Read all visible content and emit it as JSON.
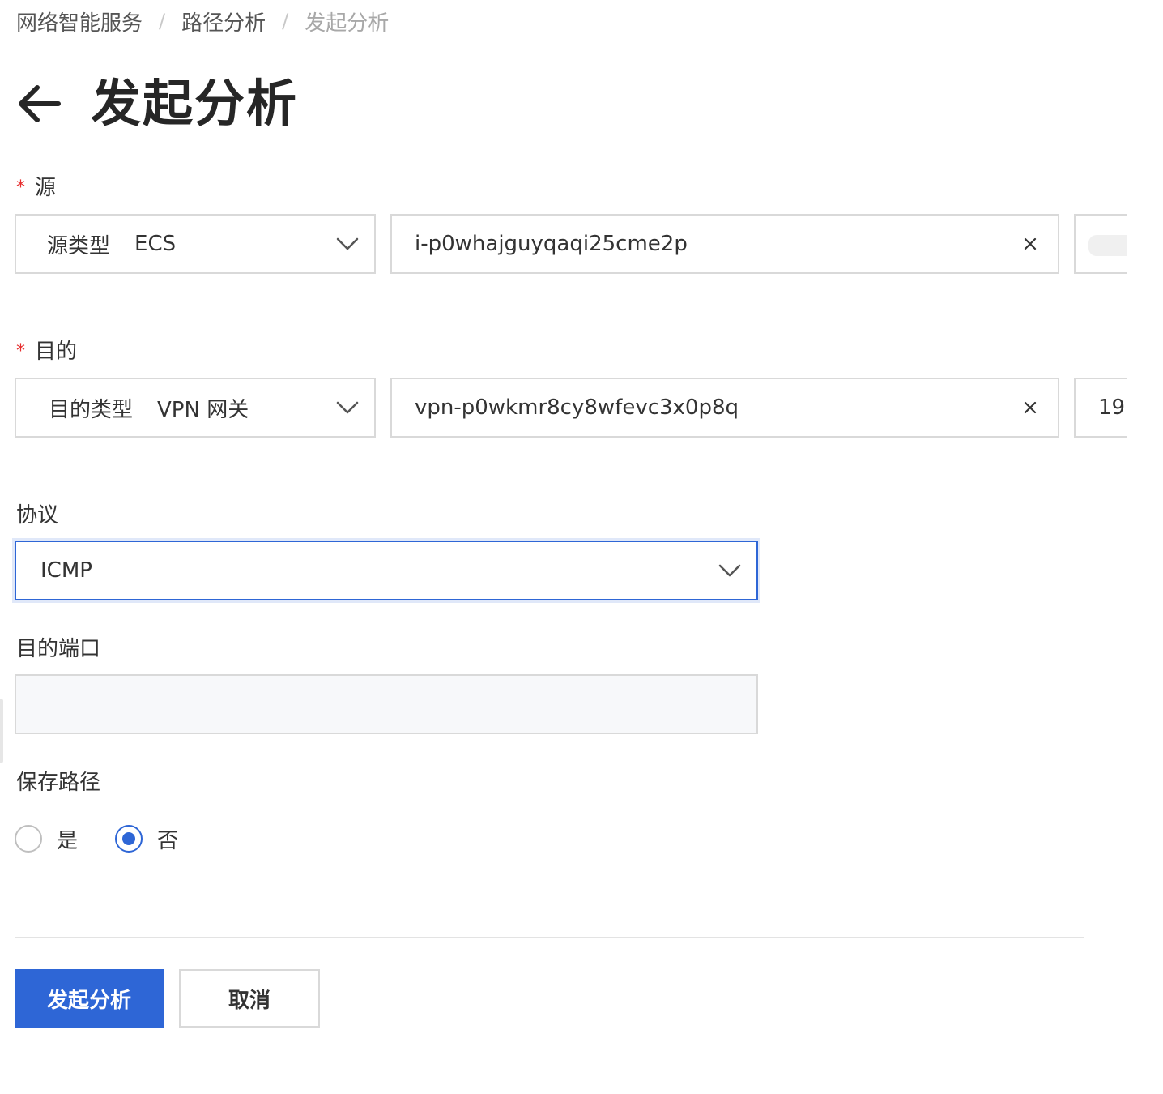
{
  "breadcrumb": {
    "items": [
      "网络智能服务",
      "路径分析",
      "发起分析"
    ],
    "separator": "/"
  },
  "page_title": "发起分析",
  "source": {
    "label": "源",
    "type_label": "源类型",
    "type_value": "ECS",
    "instance_id": "i-p0whajguyqaqi25cme2p"
  },
  "destination": {
    "label": "目的",
    "type_label": "目的类型",
    "type_value": "VPN 网关",
    "instance_id": "vpn-p0wkmr8cy8wfevc3x0p8q",
    "ip_partial": "192"
  },
  "protocol": {
    "label": "协议",
    "value": "ICMP"
  },
  "dest_port": {
    "label": "目的端口",
    "value": ""
  },
  "save_path": {
    "label": "保存路径",
    "options": [
      "是",
      "否"
    ],
    "selected": "否"
  },
  "actions": {
    "submit_label": "发起分析",
    "cancel_label": "取消"
  },
  "colors": {
    "primary": "#2e66d6",
    "required": "#e62e2e",
    "border": "#d9d9d9",
    "disabled_bg": "#f7f8fa"
  },
  "icons": [
    "arrow-left-icon",
    "chevron-down-icon",
    "close-icon"
  ]
}
